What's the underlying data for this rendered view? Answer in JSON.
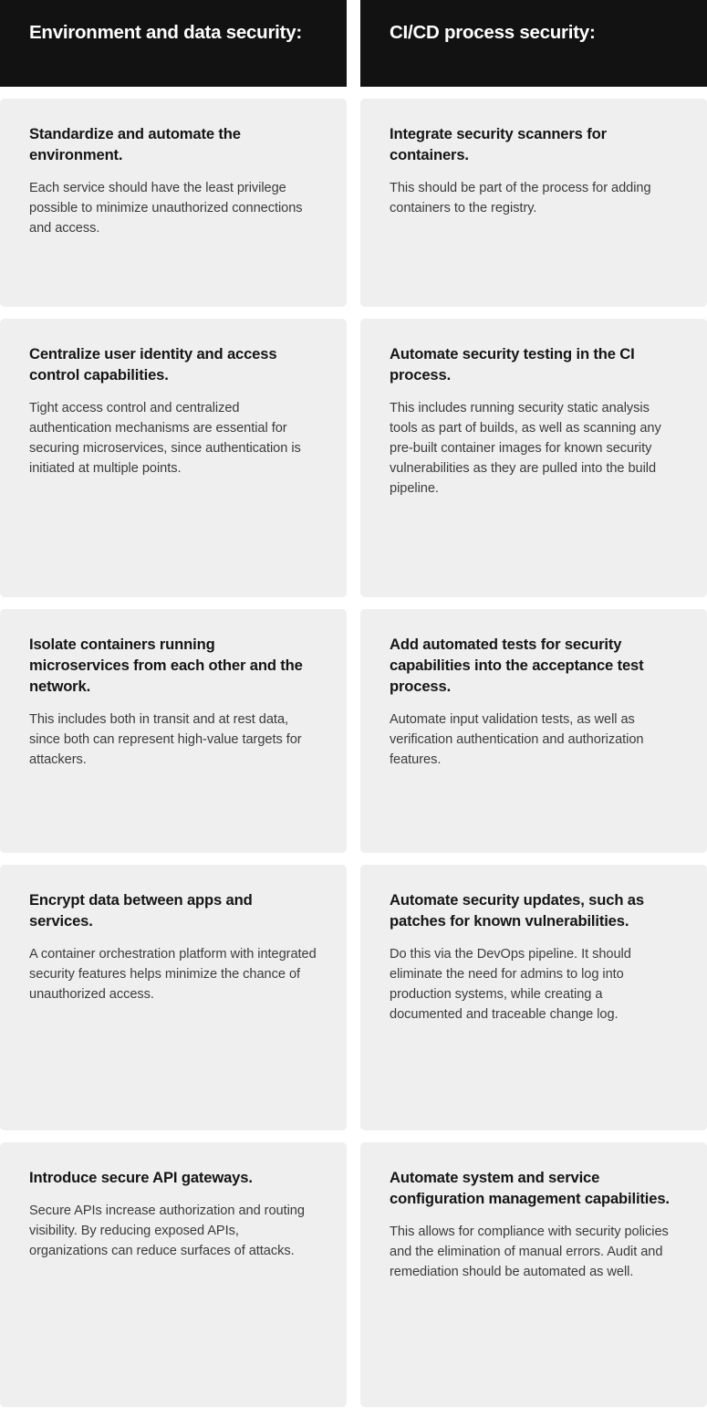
{
  "theme": {
    "header_background": "#121212",
    "header_text": "#ffffff",
    "card_background": "#efeff0",
    "card_title_text": "#151515",
    "card_body_text": "#3b3b3b",
    "page_background": "#ffffff"
  },
  "columns": [
    {
      "header": "Environment and data security:",
      "cards": [
        {
          "title": "Standardize and automate the environment.",
          "body": "Each service should have the least privilege possible to minimize unauthorized connections and access."
        },
        {
          "title": "Centralize user identity and access control capabilities.",
          "body": "Tight access control and centralized authentication mechanisms are essential for securing microservices, since authentication is initiated at multiple points."
        },
        {
          "title": "Isolate containers running microservices from each other and the network.",
          "body": "This includes both in transit and at rest data, since both can represent high-value targets for attackers."
        },
        {
          "title": "Encrypt data between apps and services.",
          "body": "A container orchestration platform with integrated security features helps minimize the chance of unauthorized access."
        },
        {
          "title": "Introduce secure API gateways.",
          "body": "Secure APIs increase authorization and routing visibility. By reducing exposed APIs, organizations can reduce surfaces of attacks."
        }
      ]
    },
    {
      "header": "CI/CD process security:",
      "cards": [
        {
          "title": "Integrate security scanners for containers.",
          "body": "This should be part of the process for adding containers to the registry."
        },
        {
          "title": "Automate security testing in the CI process.",
          "body": "This includes running security static analysis tools as part of builds, as well as scanning any pre-built container images for known security vulnerabilities as they are pulled into the build pipeline."
        },
        {
          "title": "Add automated tests for security capabilities into the acceptance test process.",
          "body": "Automate input validation tests, as well as verification authentication and authorization features."
        },
        {
          "title": "Automate security updates, such as patches for known vulnerabilities.",
          "body": "Do this via the DevOps pipeline. It should eliminate the need for admins to log into production systems, while creating a documented and traceable change log."
        },
        {
          "title": "Automate system and service configuration management capabilities.",
          "body": "This allows for compliance with security policies and the elimination of manual errors. Audit and remediation should be automated as well."
        }
      ]
    }
  ]
}
